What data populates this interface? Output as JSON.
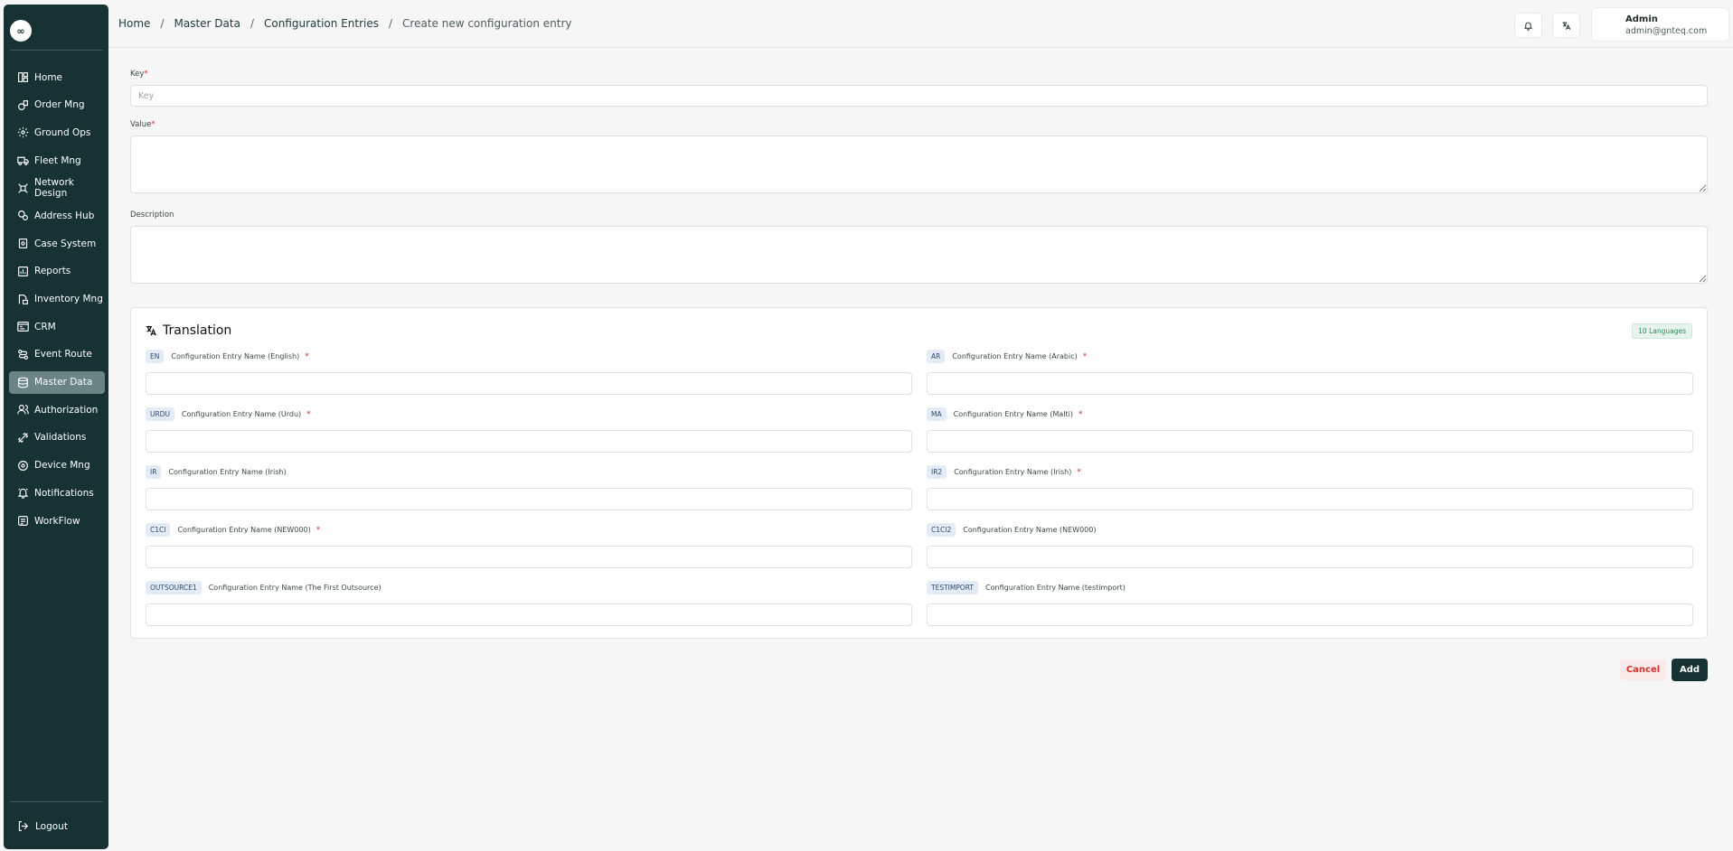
{
  "app": {
    "logo_text": "∞"
  },
  "sidebar": {
    "items": [
      {
        "label": "Home",
        "icon": "home-icon",
        "active": false
      },
      {
        "label": "Order Mng",
        "icon": "box-icon",
        "active": false
      },
      {
        "label": "Ground Ops",
        "icon": "radar-icon",
        "active": false
      },
      {
        "label": "Fleet Mng",
        "icon": "truck-icon",
        "active": false
      },
      {
        "label": "Network Design",
        "icon": "network-icon",
        "active": false
      },
      {
        "label": "Address Hub",
        "icon": "map-pin-icon",
        "active": false
      },
      {
        "label": "Case System",
        "icon": "case-icon",
        "active": false
      },
      {
        "label": "Reports",
        "icon": "chart-icon",
        "active": false
      },
      {
        "label": "Inventory Mng",
        "icon": "inventory-icon",
        "active": false
      },
      {
        "label": "CRM",
        "icon": "crm-icon",
        "active": false
      },
      {
        "label": "Event Route",
        "icon": "route-icon",
        "active": false
      },
      {
        "label": "Master Data",
        "icon": "database-icon",
        "active": true
      },
      {
        "label": "Authorization",
        "icon": "users-icon",
        "active": false
      },
      {
        "label": "Validations",
        "icon": "check-icon",
        "active": false
      },
      {
        "label": "Device Mng",
        "icon": "device-icon",
        "active": false
      },
      {
        "label": "Notifications",
        "icon": "bell-icon",
        "active": false
      },
      {
        "label": "WorkFlow",
        "icon": "workflow-icon",
        "active": false
      }
    ],
    "logout_label": "Logout"
  },
  "header": {
    "breadcrumb": [
      "Home",
      "Master Data",
      "Configuration Entries"
    ],
    "breadcrumb_current": "Create new configuration entry",
    "user": {
      "name": "Admin",
      "email": "admin@gnteq.com"
    }
  },
  "form": {
    "key": {
      "label": "Key",
      "required_mark": "*",
      "placeholder": "Key",
      "value": ""
    },
    "value": {
      "label": "Value",
      "required_mark": "*",
      "value": ""
    },
    "description": {
      "label": "Description",
      "value": ""
    }
  },
  "translation": {
    "title": "Translation",
    "badge": "10 Languages",
    "fields": [
      {
        "code": "EN",
        "label": "Configuration Entry Name (English)",
        "required": true,
        "value": ""
      },
      {
        "code": "AR",
        "label": "Configuration Entry Name (Arabic)",
        "required": true,
        "value": ""
      },
      {
        "code": "URDU",
        "label": "Configuration Entry Name (Urdu)",
        "required": true,
        "value": ""
      },
      {
        "code": "MA",
        "label": "Configuration Entry Name (Malti)",
        "required": true,
        "value": ""
      },
      {
        "code": "IR",
        "label": "Configuration Entry Name (Irish)",
        "required": false,
        "value": ""
      },
      {
        "code": "IR2",
        "label": "Configuration Entry Name (Irish)",
        "required": true,
        "value": ""
      },
      {
        "code": "C1CI",
        "label": "Configuration Entry Name (NEW000)",
        "required": true,
        "value": ""
      },
      {
        "code": "C1CI2",
        "label": "Configuration Entry Name (NEW000)",
        "required": false,
        "value": ""
      },
      {
        "code": "OUTSOURCE1",
        "label": "Configuration Entry Name (The First Outsource)",
        "required": false,
        "value": ""
      },
      {
        "code": "TESTIMPORT",
        "label": "Configuration Entry Name (testimport)",
        "required": false,
        "value": ""
      }
    ],
    "required_mark": "*"
  },
  "actions": {
    "cancel_label": "Cancel",
    "add_label": "Add"
  },
  "colors": {
    "sidebar_bg": "#163232",
    "active_item": "#6a8583",
    "danger": "#d32f2f",
    "success": "#2e8b57"
  }
}
